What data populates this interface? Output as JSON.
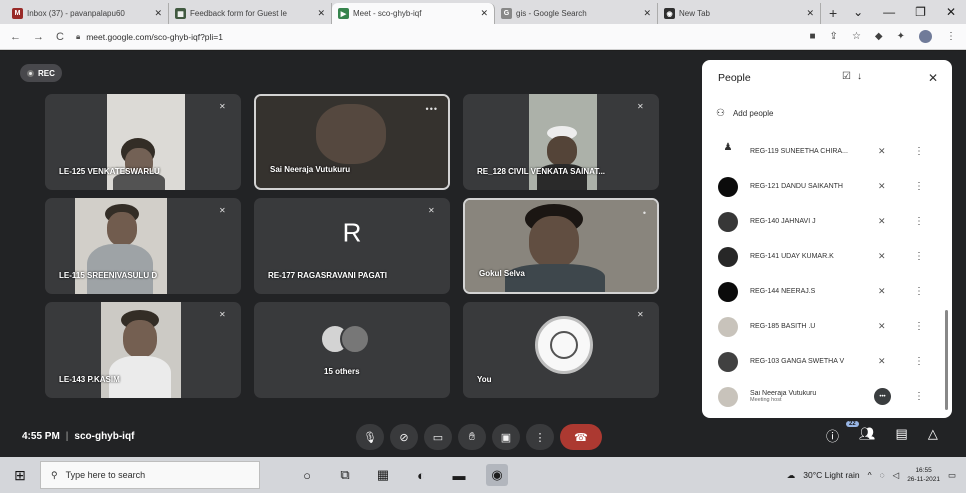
{
  "browser": {
    "tabs": [
      {
        "title": "Inbox (37) - pavanpalapu60",
        "fav_color": "#c5221f",
        "fav": "M"
      },
      {
        "title": "Feedback form for Guest le",
        "fav_color": "#3b5f3b",
        "fav": "▦"
      },
      {
        "title": "Meet - sco-ghyb-iqf",
        "fav_color": "#1e8e3e",
        "fav": "▶"
      },
      {
        "title": "gis - Google Search",
        "fav_color": "#888888",
        "fav": "G"
      },
      {
        "title": "New Tab",
        "fav_color": "#333333",
        "fav": "◉"
      }
    ],
    "url": "meet.google.com/sco-ghyb-iqf?pli=1"
  },
  "meet": {
    "rec_label": "REC",
    "meeting_time": "4:55 PM",
    "meeting_code": "sco-ghyb-iqf",
    "participants_badge": "22",
    "tiles": [
      {
        "name": "LE-125 VENKATESWARLU"
      },
      {
        "name": "Sai Neeraja Vutukuru"
      },
      {
        "name": "RE_128 CIVIL VENKATA SAINAT..."
      },
      {
        "name": "LE-115 SREENIVASULU D"
      },
      {
        "name": "RE-177 RAGASRAVANI PAGATI",
        "letter": "R"
      },
      {
        "name": "Gokul Selva"
      },
      {
        "name": "LE-143 P.KASIM"
      },
      {
        "name": "15 others"
      },
      {
        "name": "You"
      }
    ]
  },
  "people": {
    "title": "People",
    "add_people": "Add people",
    "list": [
      {
        "name": "REG-119 SUNEETHA CHIRA..."
      },
      {
        "name": "REG-121 DANDU SAIKANTH"
      },
      {
        "name": "REG-140 JAHNAVI J"
      },
      {
        "name": "REG-141 UDAY KUMAR.K"
      },
      {
        "name": "REG-144 NEERAJ.S"
      },
      {
        "name": "REG-185 BASITH .U"
      },
      {
        "name": "REG-103 GANGA SWETHA V"
      },
      {
        "name": "Sai Neeraja Vutukuru",
        "sub": "Meeting host"
      }
    ]
  },
  "taskbar": {
    "search_placeholder": "Type here to search",
    "weather": "30°C  Light rain",
    "time": "16:55",
    "date": "26-11-2021"
  }
}
